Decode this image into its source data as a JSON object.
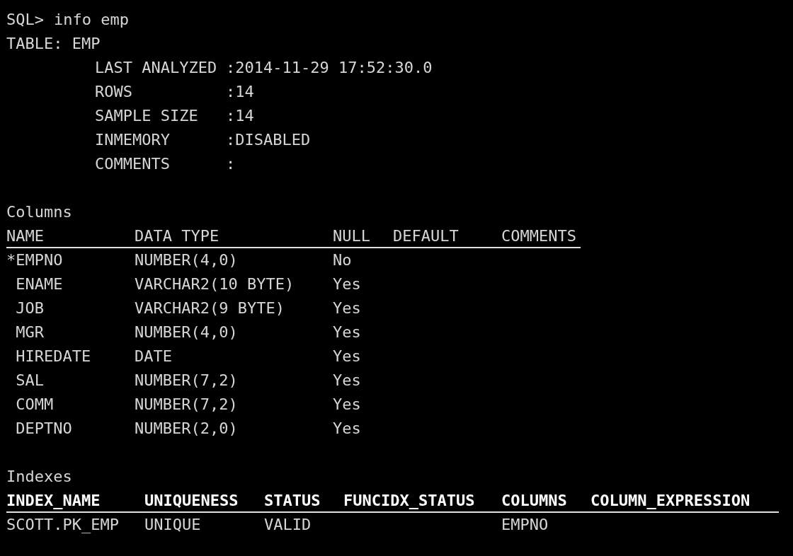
{
  "prompt": "SQL>",
  "command": "info emp",
  "table_line": "TABLE: EMP",
  "table_info": [
    {
      "label": "LAST ANALYZED",
      "value": ":2014-11-29 17:52:30.0"
    },
    {
      "label": "ROWS",
      "value": ":14"
    },
    {
      "label": "SAMPLE SIZE",
      "value": ":14"
    },
    {
      "label": "INMEMORY",
      "value": ":DISABLED"
    },
    {
      "label": "COMMENTS",
      "value": ":"
    }
  ],
  "columns_title": "Columns",
  "columns_table": {
    "columns": [
      "NAME",
      "DATA TYPE",
      "NULL",
      "DEFAULT",
      "COMMENTS"
    ],
    "rows": [
      [
        "*EMPNO",
        "NUMBER(4,0)",
        "No"
      ],
      [
        " ENAME",
        "VARCHAR2(10 BYTE)",
        "Yes"
      ],
      [
        " JOB",
        "VARCHAR2(9 BYTE)",
        "Yes"
      ],
      [
        " MGR",
        "NUMBER(4,0)",
        "Yes"
      ],
      [
        " HIREDATE",
        "DATE",
        "Yes"
      ],
      [
        " SAL",
        "NUMBER(7,2)",
        "Yes"
      ],
      [
        " COMM",
        "NUMBER(7,2)",
        "Yes"
      ],
      [
        " DEPTNO",
        "NUMBER(2,0)",
        "Yes"
      ]
    ]
  },
  "indexes_title": "Indexes",
  "indexes_table": {
    "columns": [
      "INDEX_NAME",
      "UNIQUENESS",
      "STATUS",
      "FUNCIDX_STATUS",
      "COLUMNS",
      "COLUMN_EXPRESSION"
    ],
    "rows": [
      [
        "SCOTT.PK_EMP",
        "UNIQUE",
        "VALID",
        "",
        "EMPNO"
      ]
    ]
  }
}
